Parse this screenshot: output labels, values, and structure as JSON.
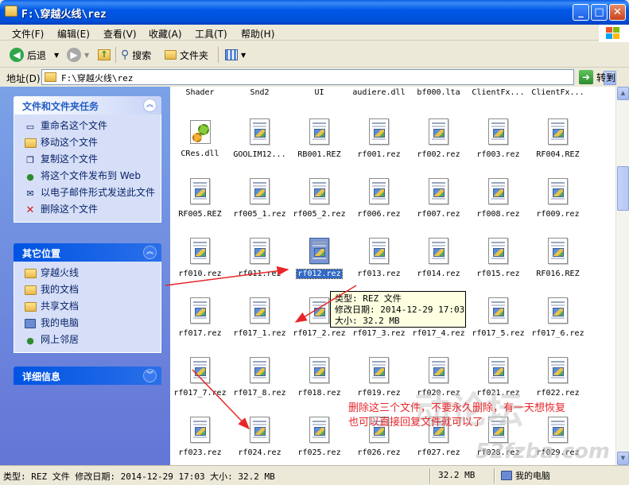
{
  "window": {
    "title": "F:\\穿越火线\\rez",
    "minimize": "_",
    "maximize": "□",
    "close": "✕"
  },
  "menu": [
    "文件(F)",
    "编辑(E)",
    "查看(V)",
    "收藏(A)",
    "工具(T)",
    "帮助(H)"
  ],
  "toolbar": {
    "back": "后退",
    "search": "搜索",
    "folders": "文件夹"
  },
  "address": {
    "label": "地址(D)",
    "path": "F:\\穿越火线\\rez",
    "go": "转到"
  },
  "file_tasks": {
    "title": "文件和文件夹任务",
    "items": [
      "重命名这个文件",
      "移动这个文件",
      "复制这个文件",
      "将这个文件发布到 Web",
      "以电子邮件形式发送此文件",
      "删除这个文件"
    ]
  },
  "other_places": {
    "title": "其它位置",
    "items": [
      "穿越火线",
      "我的文档",
      "共享文档",
      "我的电脑",
      "网上邻居"
    ]
  },
  "details": {
    "title": "详细信息"
  },
  "files": {
    "r0": [
      "Shader",
      "Snd2",
      "UI",
      "audiere.dll",
      "bf000.lta",
      "ClientFx...",
      "ClientFx..."
    ],
    "r1": [
      "CRes.dll",
      "GOOLIM12...",
      "RB001.REZ",
      "rf001.rez",
      "rf002.rez",
      "rf003.rez",
      "RF004.REZ"
    ],
    "r2": [
      "RF005.REZ",
      "rf005_1.rez",
      "rf005_2.rez",
      "rf006.rez",
      "rf007.rez",
      "rf008.rez",
      "rf009.rez"
    ],
    "r3": [
      "rf010.rez",
      "rf011.rez",
      "rf012.rez",
      "rf013.rez",
      "rf014.rez",
      "rf015.rez",
      "RF016.REZ"
    ],
    "r4": [
      "rf017.rez",
      "rf017_1.rez",
      "rf017_2.rez",
      "rf017_3.rez",
      "rf017_4.rez",
      "rf017_5.rez",
      "rf017_6.rez"
    ],
    "r5": [
      "rf017_7.rez",
      "rf017_8.rez",
      "rf018.rez",
      "rf019.rez",
      "rf020.rez",
      "rf021.rez",
      "rf022.rez"
    ],
    "r6": [
      "rf023.rez",
      "rf024.rez",
      "rf025.rez",
      "rf026.rez",
      "rf027.rez",
      "rf028.rez",
      "rf029.rez"
    ]
  },
  "tooltip": {
    "line1": "类型: REZ 文件",
    "line2": "修改日期: 2014-12-29 17:03",
    "line3": "大小: 32.2 MB"
  },
  "annotation": {
    "line1": "删除这三个文件，不要永久删除，有一天想恢复",
    "line2": "也可以直接回复文件就可以了"
  },
  "watermark": {
    "text": "动论坛",
    "url": "52fzba.com"
  },
  "status": {
    "main": "类型: REZ 文件 修改日期: 2014-12-29 17:03 大小: 32.2 MB",
    "size": "32.2 MB",
    "zone": "我的电脑"
  },
  "colors": {
    "titlebar": "#0058E6",
    "taskpane": "#6375D6",
    "selection": "#316AC5",
    "annotation": "#E8262A"
  }
}
